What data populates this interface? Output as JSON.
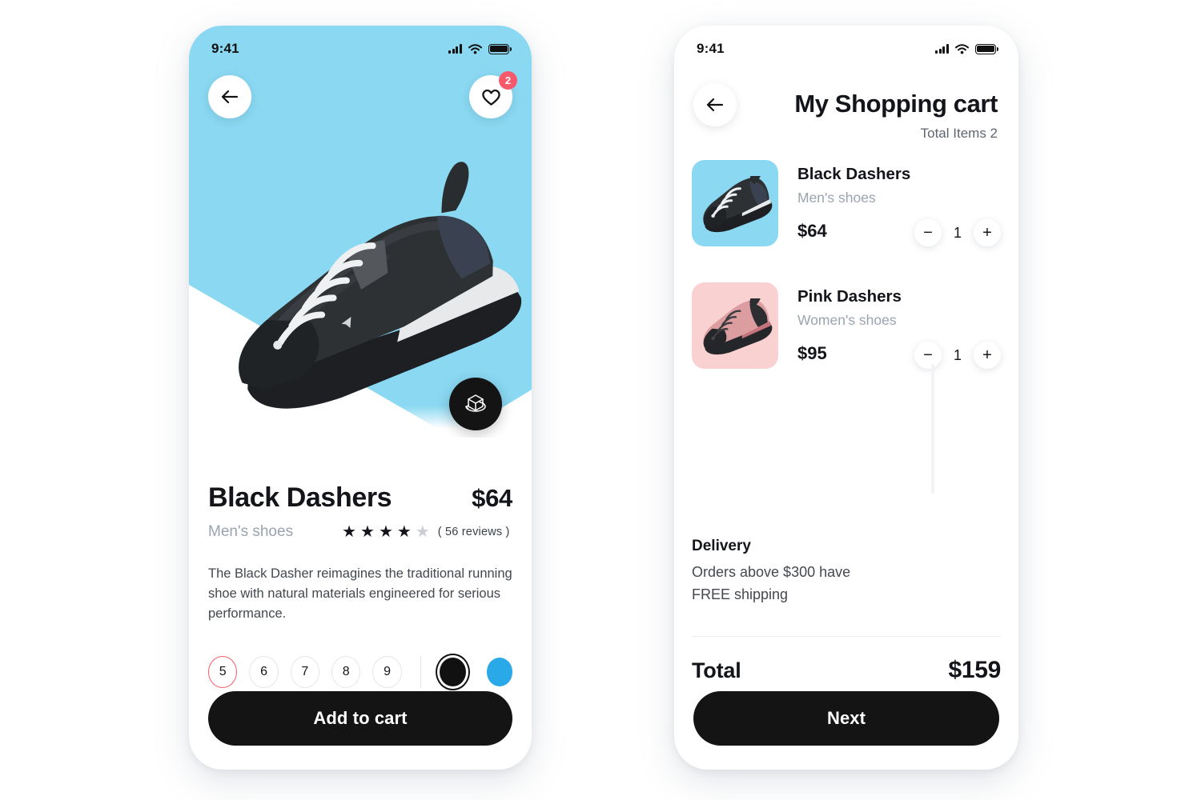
{
  "theme": {
    "cyan": "#8ad8f2",
    "cyan_strong": "#29a9e8",
    "coral": "#f6596a",
    "pink": "#fad1d1",
    "dark": "#141414",
    "muted": "#9aa3b0"
  },
  "status_bar": {
    "time": "9:41"
  },
  "product_screen": {
    "back_icon": "arrow-left-icon",
    "favorite_icon": "heart-icon",
    "favorite_count": "2",
    "ar_icon": "3d-cube-icon",
    "title": "Black Dashers",
    "price": "$64",
    "category": "Men's shoes",
    "rating_filled": 4,
    "rating_total": 5,
    "reviews": "( 56 reviews )",
    "description": "The Black Dasher reimagines the traditional running shoe with natural materials engineered for serious performance.",
    "sizes": [
      {
        "label": "5",
        "selected": true
      },
      {
        "label": "6",
        "selected": false
      },
      {
        "label": "7",
        "selected": false
      },
      {
        "label": "8",
        "selected": false
      },
      {
        "label": "9",
        "selected": false
      }
    ],
    "colors": [
      {
        "name": "black-swatch",
        "hex": "#111111",
        "selected": true
      },
      {
        "name": "blue-swatch",
        "hex": "#29a9e8",
        "selected": false
      }
    ],
    "cta_label": "Add to cart"
  },
  "cart_screen": {
    "back_icon": "arrow-left-icon",
    "title": "My Shopping cart",
    "total_items": "Total Items 2",
    "items": [
      {
        "name": "Black Dashers",
        "category": "Men's shoes",
        "price": "$64",
        "quantity": "1",
        "decrement": "−",
        "increment": "+",
        "thumb_color": "#8ad8f2"
      },
      {
        "name": "Pink Dashers",
        "category": "Women's shoes",
        "price": "$95",
        "quantity": "1",
        "decrement": "−",
        "increment": "+",
        "thumb_color": "#fad1d1"
      }
    ],
    "delivery_title": "Delivery",
    "delivery_line_1": "Orders above $300 have",
    "delivery_line_2": "FREE shipping",
    "total_label": "Total",
    "total_value": "$159",
    "cta_label": "Next"
  }
}
